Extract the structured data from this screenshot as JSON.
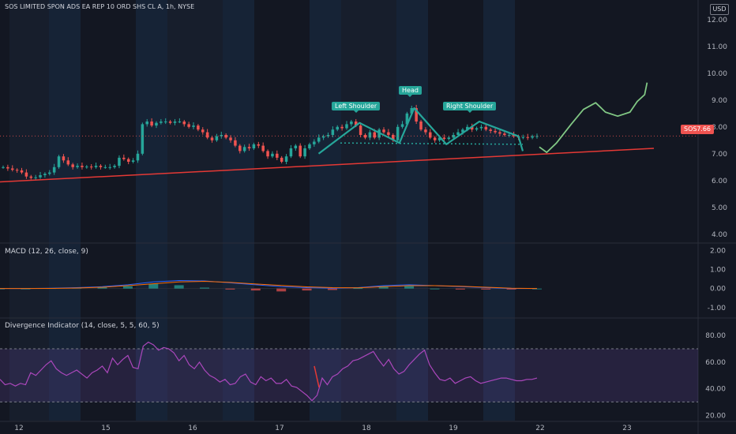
{
  "header": {
    "title": "SOS LIMITED SPON ADS EA REP 10 ORD SHS CL A, 1h, NYSE",
    "currency": "USD"
  },
  "colors": {
    "background": "#131722",
    "session_band": "#1a2d47",
    "up_candle": "#26a69a",
    "down_candle": "#ef5350",
    "trendline": "#e53935",
    "projection": "#81c784",
    "pattern": "#26a69a",
    "macd_line": "#2962ff",
    "signal_line": "#ff6d00",
    "rsi_line": "#ab47bc"
  },
  "badge": {
    "symbol": "SOS",
    "value": "7.66"
  },
  "annotations": {
    "left_shoulder": "Left Shoulder",
    "head": "Head",
    "right_shoulder": "Right Shoulder"
  },
  "macd_title": "MACD (12, 26, close, 9)",
  "div_title": "Divergence Indicator (14, close, 5, 5, 60, 5)",
  "chart_data": [
    {
      "type": "candlestick",
      "title": "SOS LIMITED SPON ADS EA REP 10 ORD SHS CL A, 1h, NYSE",
      "ylim": [
        3.7,
        12.2
      ],
      "price_ticks": [
        "4.00",
        "5.00",
        "6.00",
        "7.00",
        "8.00",
        "9.00",
        "10.00",
        "11.00",
        "12.00"
      ],
      "x_ticks": [
        "12",
        "15",
        "16",
        "17",
        "18",
        "19",
        "22",
        "23"
      ],
      "x_ticks_day_index": [
        0,
        1,
        2,
        3,
        4,
        5,
        6,
        7
      ],
      "last_price": 7.66,
      "closes": [
        6.5,
        6.45,
        6.4,
        6.38,
        6.3,
        6.15,
        6.1,
        6.12,
        6.2,
        6.25,
        6.3,
        6.5,
        6.9,
        6.75,
        6.6,
        6.5,
        6.55,
        6.5,
        6.52,
        6.5,
        6.55,
        6.5,
        6.5,
        6.5,
        6.55,
        6.85,
        6.8,
        6.7,
        6.75,
        7.0,
        8.1,
        8.2,
        8.05,
        8.15,
        8.2,
        8.2,
        8.15,
        8.2,
        8.2,
        8.1,
        8.0,
        8.05,
        7.9,
        7.8,
        7.6,
        7.5,
        7.65,
        7.7,
        7.6,
        7.5,
        7.3,
        7.1,
        7.25,
        7.2,
        7.35,
        7.3,
        7.1,
        6.9,
        7.0,
        6.85,
        6.7,
        6.9,
        7.2,
        7.3,
        6.9,
        7.2,
        7.35,
        7.45,
        7.6,
        7.65,
        7.7,
        7.9,
        8.0,
        7.95,
        8.1,
        8.2,
        8.05,
        7.7,
        7.6,
        7.8,
        7.6,
        7.9,
        7.8,
        7.7,
        7.5,
        8.0,
        8.1,
        8.5,
        8.7,
        8.2,
        7.9,
        7.8,
        7.6,
        7.5,
        7.6,
        7.55,
        7.6,
        7.7,
        7.8,
        7.9,
        8.0,
        7.9,
        7.95,
        8.0,
        7.9,
        7.85,
        7.8,
        7.75,
        7.7,
        7.7,
        7.65,
        7.6,
        7.62,
        7.6,
        7.65,
        7.66
      ],
      "pattern_points": [
        [
          17.45,
          7.0
        ],
        [
          17.92,
          8.15
        ],
        [
          18.38,
          7.4
        ],
        [
          18.55,
          8.7
        ],
        [
          18.92,
          7.35
        ],
        [
          19.3,
          8.2
        ],
        [
          19.75,
          7.65
        ],
        [
          20.0,
          7.1
        ]
      ],
      "neckline": [
        [
          17.7,
          7.4
        ],
        [
          19.8,
          7.35
        ]
      ],
      "trendline": [
        [
          12.0,
          5.95
        ],
        [
          23.3,
          7.2
        ]
      ],
      "projection": [
        [
          20.0,
          7.25
        ],
        [
          20.15,
          7.05
        ],
        [
          20.35,
          7.4
        ],
        [
          20.65,
          8.1
        ],
        [
          20.9,
          8.65
        ],
        [
          21.15,
          8.9
        ],
        [
          21.35,
          8.55
        ],
        [
          21.6,
          8.4
        ],
        [
          21.85,
          8.55
        ],
        [
          22.0,
          8.95
        ],
        [
          22.15,
          9.2
        ],
        [
          22.2,
          9.65
        ]
      ]
    },
    {
      "type": "line",
      "title": "MACD (12, 26, close, 9)",
      "ylim": [
        -1.5,
        2.3
      ],
      "ticks": [
        "2.00",
        "1.00",
        "0.00",
        "-1.00"
      ],
      "series": [
        {
          "values": [
            0.0,
            0.0,
            0.02,
            0.05,
            0.1,
            0.2,
            0.35,
            0.42,
            0.4,
            0.3,
            0.2,
            0.1,
            0.05,
            0.02,
            0.05,
            0.15,
            0.2,
            0.15,
            0.1,
            0.05,
            0.0,
            0.0
          ]
        },
        {
          "values": [
            0.0,
            0.0,
            0.01,
            0.03,
            0.07,
            0.15,
            0.25,
            0.35,
            0.38,
            0.32,
            0.24,
            0.16,
            0.09,
            0.05,
            0.04,
            0.1,
            0.15,
            0.15,
            0.12,
            0.07,
            0.02,
            0.0
          ]
        }
      ]
    },
    {
      "type": "line",
      "title": "Divergence Indicator (14, close, 5, 5, 60, 5)",
      "ylim": [
        16,
        92
      ],
      "ticks": [
        "80.00",
        "60.00",
        "40.00",
        "20.00"
      ],
      "bands": {
        "overbought": 70,
        "oversold": 30
      },
      "series": [
        {
          "values": [
            47,
            43,
            44,
            42,
            44,
            43,
            52,
            50,
            54,
            58,
            61,
            55,
            52,
            50,
            52,
            54,
            51,
            48,
            52,
            54,
            57,
            52,
            63,
            58,
            62,
            65,
            56,
            55,
            72,
            75,
            73,
            69,
            71,
            70,
            67,
            61,
            65,
            58,
            55,
            60,
            54,
            50,
            48,
            45,
            47,
            43,
            44,
            49,
            51,
            45,
            43,
            49,
            46,
            48,
            44,
            44,
            47,
            42,
            41,
            38,
            35,
            31,
            35,
            48,
            43,
            49,
            51,
            55,
            57,
            61,
            62,
            64,
            66,
            68,
            62,
            57,
            62,
            55,
            51,
            53,
            58,
            62,
            66,
            69,
            58,
            52,
            47,
            46,
            48,
            44,
            46,
            48,
            49,
            46,
            44,
            45,
            46,
            47,
            48,
            48,
            47,
            46,
            46,
            47,
            47,
            48
          ]
        }
      ]
    }
  ]
}
